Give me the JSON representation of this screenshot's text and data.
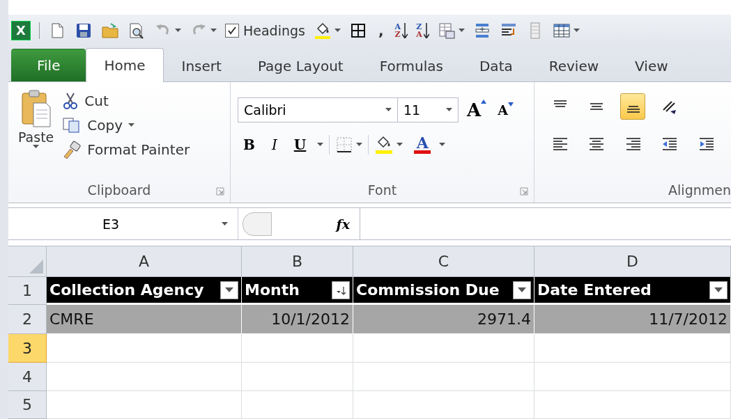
{
  "quick_access": {
    "logo": "X",
    "items": [
      {
        "kind": "new"
      },
      {
        "kind": "save"
      },
      {
        "kind": "open"
      },
      {
        "kind": "preview"
      },
      {
        "kind": "undo"
      },
      {
        "kind": "redo"
      },
      {
        "kind": "checkbox",
        "label": "Headings",
        "checked": true
      },
      {
        "kind": "fill"
      },
      {
        "kind": "borders"
      },
      {
        "kind": "text",
        "label": ","
      },
      {
        "kind": "sort",
        "top": "A",
        "bottom": "Z"
      },
      {
        "kind": "sort",
        "top": "Z",
        "bottom": "A"
      },
      {
        "kind": "table-format"
      },
      {
        "kind": "insert-row"
      },
      {
        "kind": "wrap"
      },
      {
        "kind": "sheet"
      },
      {
        "kind": "grid-menu"
      }
    ]
  },
  "tabs": [
    {
      "label": "File",
      "kind": "file",
      "selected": false
    },
    {
      "label": "Home",
      "kind": "tab",
      "selected": true
    },
    {
      "label": "Insert",
      "kind": "tab",
      "selected": false
    },
    {
      "label": "Page Layout",
      "kind": "tab",
      "selected": false
    },
    {
      "label": "Formulas",
      "kind": "tab",
      "selected": false
    },
    {
      "label": "Data",
      "kind": "tab",
      "selected": false
    },
    {
      "label": "Review",
      "kind": "tab",
      "selected": false
    },
    {
      "label": "View",
      "kind": "tab",
      "selected": false
    }
  ],
  "clipboard": {
    "paste": "Paste",
    "cut": "Cut",
    "copy": "Copy",
    "format_painter": "Format Painter",
    "label": "Clipboard"
  },
  "font": {
    "name": "Calibri",
    "size": "11",
    "grow": "A",
    "shrink": "A",
    "bold": "B",
    "italic": "I",
    "underline": "U",
    "font_color": "A",
    "label": "Font"
  },
  "alignment": {
    "label": "Alignmen",
    "buttons": [
      {
        "kind": "align-top",
        "selected": false
      },
      {
        "kind": "align-middle",
        "selected": false
      },
      {
        "kind": "align-bottom",
        "selected": true
      },
      {
        "kind": "orientation",
        "selected": false
      },
      {
        "kind": "align-left",
        "selected": false
      },
      {
        "kind": "align-center",
        "selected": false
      },
      {
        "kind": "align-right",
        "selected": false
      },
      {
        "kind": "indent-decrease",
        "selected": false
      },
      {
        "kind": "indent-increase",
        "selected": false
      }
    ]
  },
  "formula_bar": {
    "name_box": "E3",
    "fx": "fx"
  },
  "grid": {
    "columns": [
      "A",
      "B",
      "C",
      "D"
    ],
    "rows": [
      {
        "number": "1",
        "selected": false,
        "kind": "header",
        "cells": [
          {
            "text": "Collection Agency",
            "kind": "filter"
          },
          {
            "text": "Month",
            "kind": "sorted"
          },
          {
            "text": "Commission Due",
            "kind": "filter"
          },
          {
            "text": "Date Entered",
            "kind": "filter"
          }
        ]
      },
      {
        "number": "2",
        "selected": false,
        "kind": "data",
        "cells": [
          {
            "text": "CMRE",
            "kind": "text"
          },
          {
            "text": "10/1/2012",
            "kind": "number"
          },
          {
            "text": "2971.4",
            "kind": "number"
          },
          {
            "text": "11/7/2012",
            "kind": "number"
          }
        ]
      },
      {
        "number": "3",
        "selected": true,
        "kind": "empty",
        "cells": []
      },
      {
        "number": "4",
        "selected": false,
        "kind": "empty",
        "cells": []
      },
      {
        "number": "5",
        "selected": false,
        "kind": "empty",
        "cells": []
      }
    ]
  }
}
